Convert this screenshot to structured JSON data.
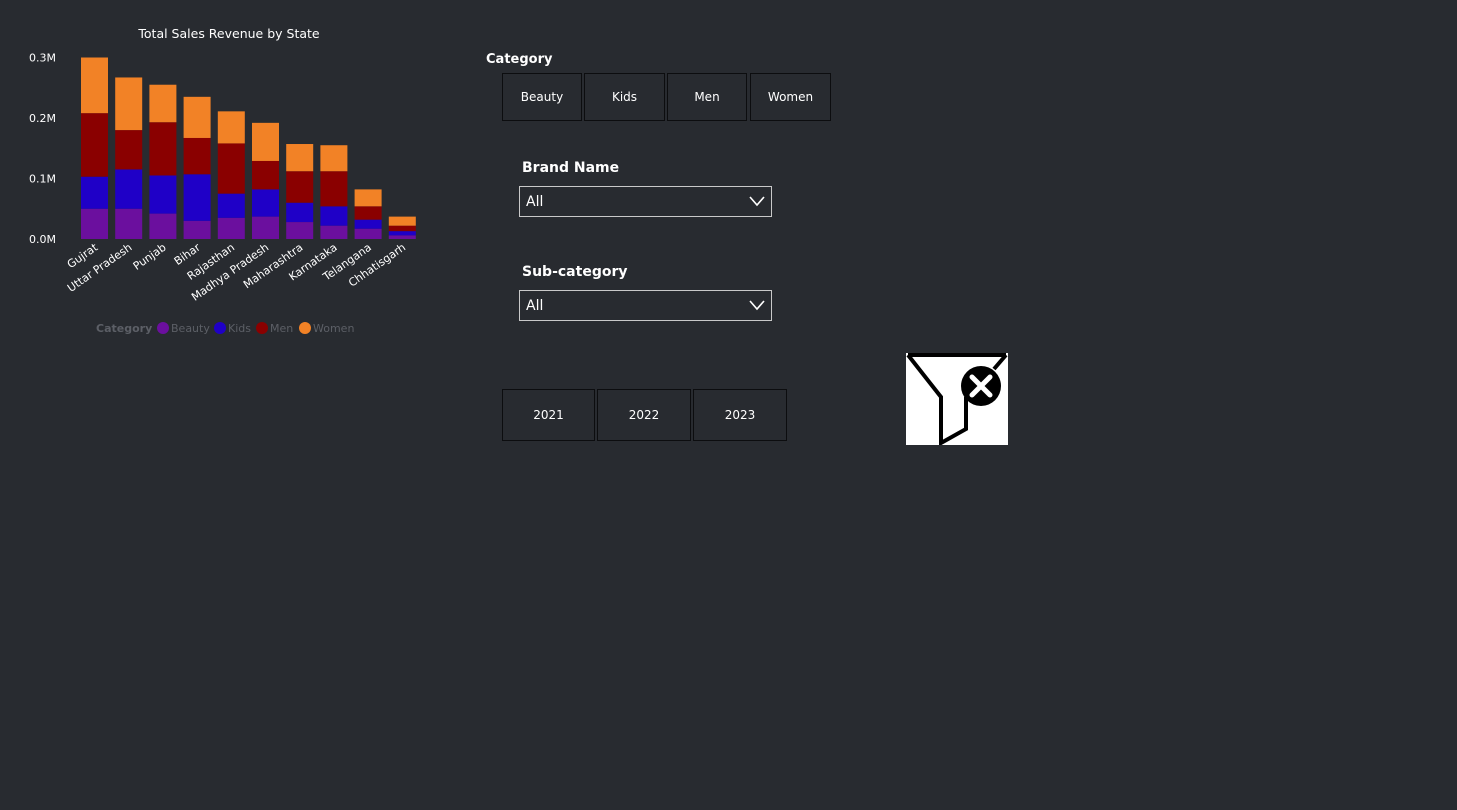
{
  "chart_data": {
    "type": "bar",
    "stacked": true,
    "title": "Total Sales Revenue by State",
    "categories": [
      "Gujrat",
      "Uttar Pradesh",
      "Punjab",
      "Bihar",
      "Rajasthan",
      "Madhya Pradesh",
      "Maharashtra",
      "Karnataka",
      "Telangana",
      "Chhatisgarh"
    ],
    "series": [
      {
        "name": "Beauty",
        "color": "#6b0f9e",
        "values": [
          0.05,
          0.05,
          0.042,
          0.03,
          0.035,
          0.037,
          0.028,
          0.022,
          0.017,
          0.006
        ]
      },
      {
        "name": "Kids",
        "color": "#1f00c7",
        "values": [
          0.053,
          0.065,
          0.063,
          0.077,
          0.04,
          0.045,
          0.032,
          0.032,
          0.015,
          0.007
        ]
      },
      {
        "name": "Men",
        "color": "#8a0000",
        "values": [
          0.105,
          0.065,
          0.088,
          0.06,
          0.083,
          0.047,
          0.052,
          0.058,
          0.022,
          0.009
        ]
      },
      {
        "name": "Women",
        "color": "#f28226",
        "values": [
          0.092,
          0.087,
          0.062,
          0.068,
          0.053,
          0.063,
          0.045,
          0.043,
          0.028,
          0.015
        ]
      }
    ],
    "yticks": [
      "0.0M",
      "0.1M",
      "0.2M",
      "0.3M"
    ],
    "ylim": [
      0,
      0.31
    ],
    "legend_title": "Category",
    "legend_position": "bottom"
  },
  "category_slicer": {
    "label": "Category",
    "options": [
      "Beauty",
      "Kids",
      "Men",
      "Women"
    ]
  },
  "brand_filter": {
    "label": "Brand Name",
    "value": "All"
  },
  "subcategory_filter": {
    "label": "Sub-category",
    "value": "All"
  },
  "year_slicer": {
    "options": [
      "2021",
      "2022",
      "2023"
    ]
  },
  "clear_filters": {
    "icon": "clear-filter-icon"
  }
}
